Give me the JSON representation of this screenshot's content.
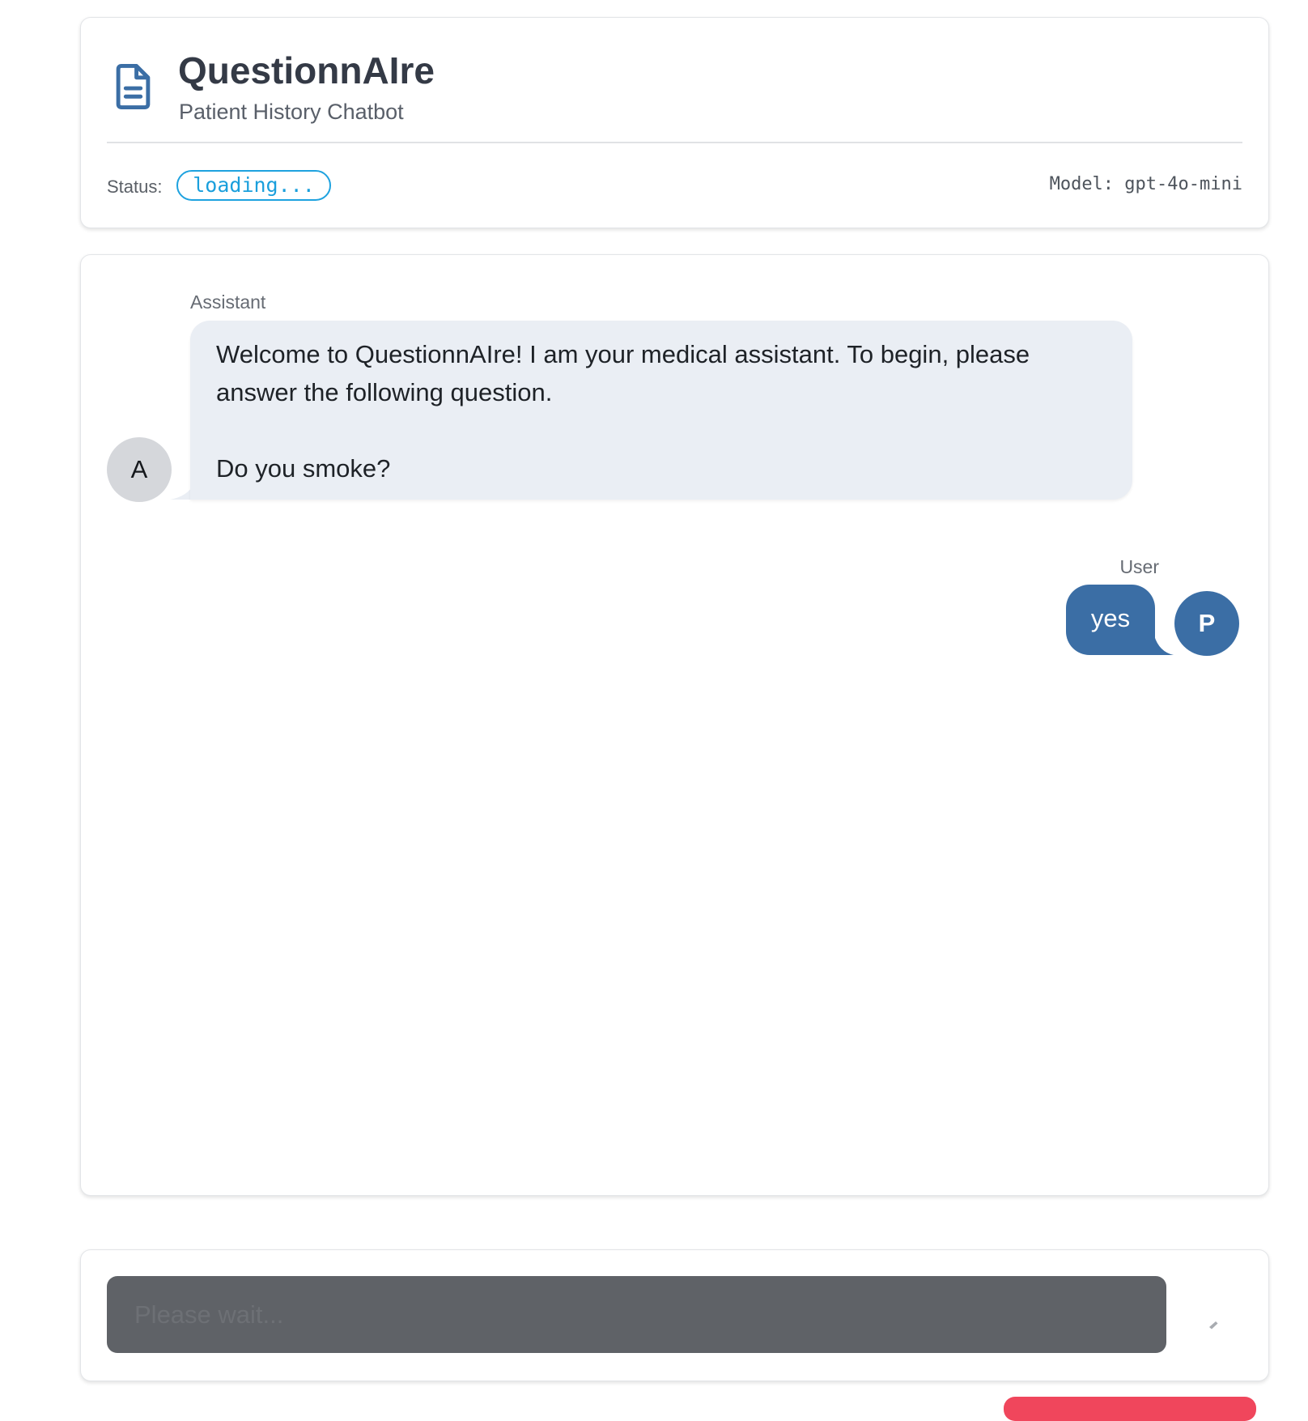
{
  "header": {
    "title": "QuestionnAIre",
    "subtitle": "Patient History Chatbot",
    "status_label": "Status:",
    "status_value": "loading...",
    "model_info": "Model: gpt-4o-mini",
    "icon": "document-icon"
  },
  "chat": {
    "messages": [
      {
        "sender": "Assistant",
        "avatar": "A",
        "text": "Welcome to QuestionnAIre! I am your medical assistant. To begin, please\nanswer the following question.\n\nDo you smoke?"
      },
      {
        "sender": "User",
        "avatar": "P",
        "text": "yes"
      }
    ]
  },
  "input": {
    "placeholder": "Please wait...",
    "value": "",
    "send_icon": "send-icon"
  },
  "colors": {
    "primary": "#3b6ea5",
    "status": "#1ea2df",
    "assistant_bubble": "#eaeef4",
    "input_background": "#5f6267",
    "danger": "#f0465c"
  }
}
